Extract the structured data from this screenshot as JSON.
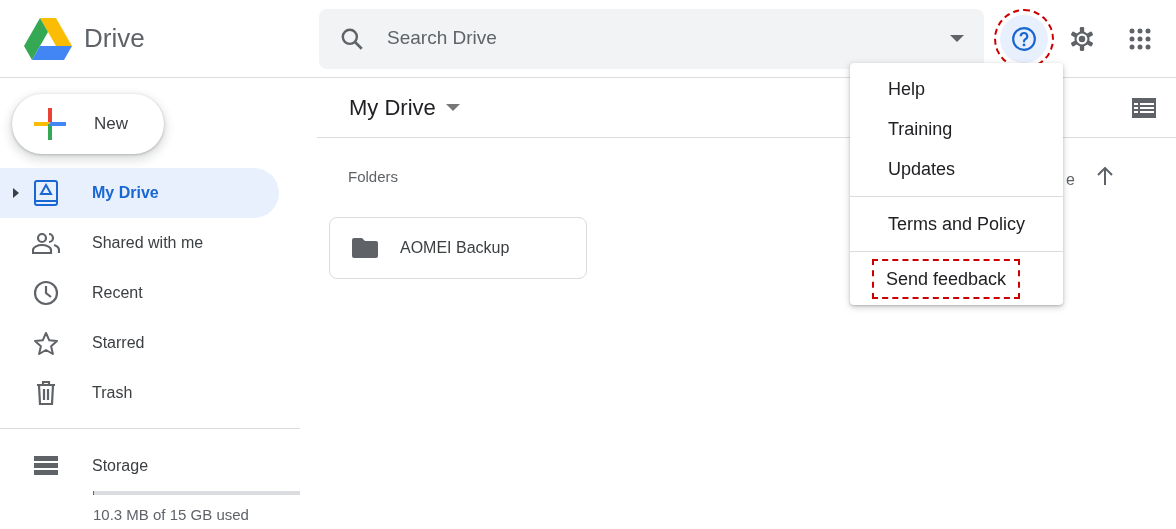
{
  "app": {
    "title": "Drive"
  },
  "search": {
    "placeholder": "Search Drive"
  },
  "header_buttons": [
    {
      "kind": "help",
      "active": true,
      "highlighted": true
    },
    {
      "kind": "settings",
      "active": false,
      "highlighted": false
    },
    {
      "kind": "apps",
      "active": false,
      "highlighted": false
    }
  ],
  "new_button": {
    "label": "New"
  },
  "sidebar": {
    "items": [
      {
        "label": "My Drive",
        "selected": true,
        "expandable": true
      },
      {
        "label": "Shared with me",
        "selected": false,
        "expandable": false
      },
      {
        "label": "Recent",
        "selected": false,
        "expandable": false
      },
      {
        "label": "Starred",
        "selected": false,
        "expandable": false
      },
      {
        "label": "Trash",
        "selected": false,
        "expandable": false
      }
    ]
  },
  "storage": {
    "label": "Storage",
    "level": 0.001,
    "usage": "10.3 MB of 15 GB used"
  },
  "main": {
    "title": "My Drive",
    "section": "Folders",
    "sort_label": "e",
    "folders": [
      {
        "name": "AOMEI Backup"
      }
    ]
  },
  "help_menu": {
    "groups": [
      [
        {
          "label": "Help",
          "highlighted": false
        },
        {
          "label": "Training",
          "highlighted": false
        },
        {
          "label": "Updates",
          "highlighted": false
        }
      ],
      [
        {
          "label": "Terms and Policy",
          "highlighted": false
        }
      ],
      [
        {
          "label": "Send feedback",
          "highlighted": true
        }
      ]
    ]
  }
}
